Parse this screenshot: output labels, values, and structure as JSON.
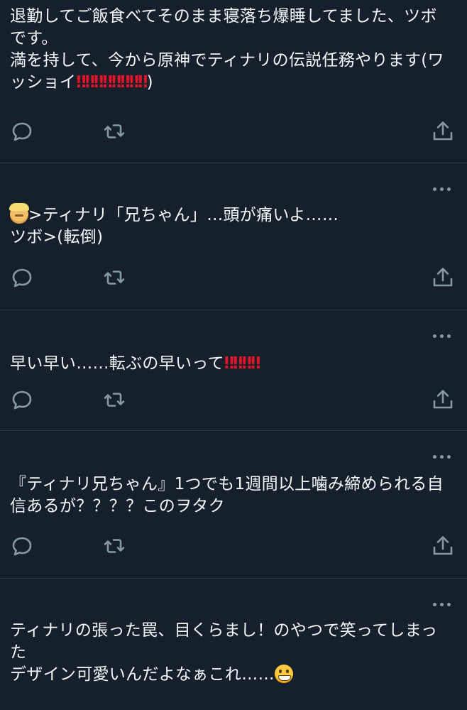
{
  "tweets": [
    {
      "text": "退勤してご飯食べてそのまま寝落ち爆睡してました、ツボです。\n満を持して、今から原神でティナリの伝説任務やります(ワッショイ",
      "bangs": "‼‼‼‼‼‼‼‼",
      "text_end": ")"
    },
    {
      "text": ">ティナリ「兄ちゃん」…頭が痛いよ……\nツボ>(転倒)"
    },
    {
      "text": "早い早い……転ぶの早いって",
      "bangs": "‼‼‼‼"
    },
    {
      "text": "『ティナリ兄ちゃん』1つでも1週間以上噛み締められる自信あるが？？？？このヲタク"
    },
    {
      "text": "ティナリの張った罠、目くらまし！のやつで笑ってしまった\nデザイン可愛いんだよなぁこれ……"
    }
  ],
  "icons": {
    "reply": "reply-bubble-icon",
    "retweet": "retweet-arrows-icon",
    "share": "share-upload-icon",
    "more": "more-dots-icon",
    "blond_person": "blond-person-emoji",
    "grin": "grinning-face-emoji"
  },
  "colors": {
    "background": "#15202b",
    "text": "#f5f8fa",
    "icon": "#8899a6",
    "divider": "#2f3b47",
    "exclamation": "#e0142a"
  }
}
